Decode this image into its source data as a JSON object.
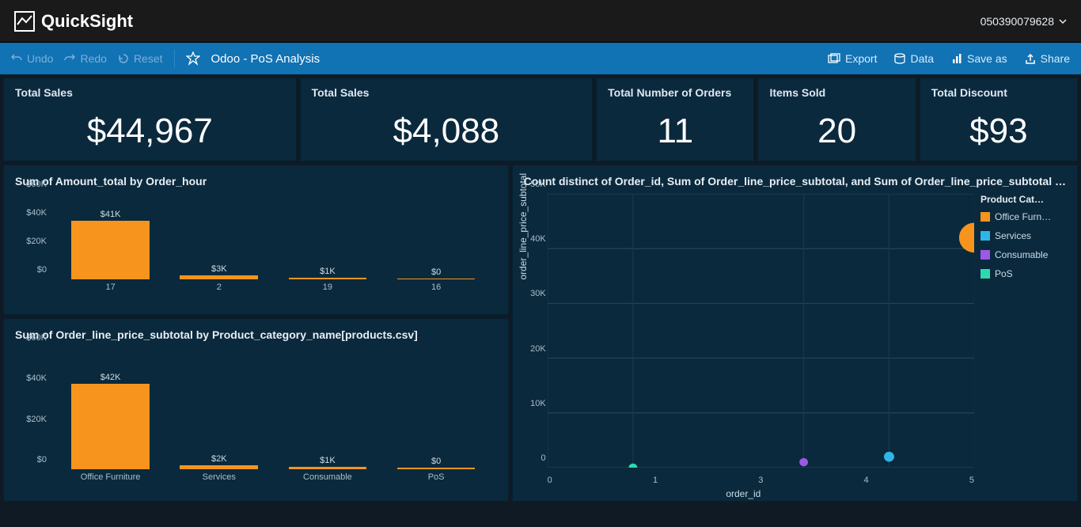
{
  "brand": "QuickSight",
  "account_id": "050390079628",
  "toolbar": {
    "undo": "Undo",
    "redo": "Redo",
    "reset": "Reset",
    "title": "Odoo - PoS Analysis",
    "export": "Export",
    "data": "Data",
    "save_as": "Save as",
    "share": "Share"
  },
  "kpis": [
    {
      "label": "Total Sales",
      "value": "$44,967",
      "wide": true
    },
    {
      "label": "Total Sales",
      "value": "$4,088",
      "wide": true
    },
    {
      "label": "Total Number of Orders",
      "value": "11",
      "wide": false
    },
    {
      "label": "Items Sold",
      "value": "20",
      "wide": false
    },
    {
      "label": "Total Discount",
      "value": "$93",
      "wide": false
    }
  ],
  "chart_data": [
    {
      "id": "chart1",
      "type": "bar",
      "title": "Sum of Amount_total by Order_hour",
      "ylabel": "",
      "xlabel": "",
      "ylim": [
        0,
        60000
      ],
      "yticks": [
        "$0",
        "$20K",
        "$40K",
        "$60K"
      ],
      "categories": [
        "17",
        "2",
        "19",
        "16"
      ],
      "values": [
        41000,
        3000,
        1000,
        0
      ],
      "value_labels": [
        "$41K",
        "$3K",
        "$1K",
        "$0"
      ]
    },
    {
      "id": "chart2",
      "type": "bar",
      "title": "Sum of Order_line_price_subtotal by Product_category_name[products.csv]",
      "ylabel": "",
      "xlabel": "",
      "ylim": [
        0,
        60000
      ],
      "yticks": [
        "$0",
        "$20K",
        "$40K",
        "$60K"
      ],
      "categories": [
        "Office Furniture",
        "Services",
        "Consumable",
        "PoS"
      ],
      "values": [
        42000,
        2000,
        1000,
        0
      ],
      "value_labels": [
        "$42K",
        "$2K",
        "$1K",
        "$0"
      ]
    },
    {
      "id": "scatter",
      "type": "scatter",
      "title": "Count distinct of Order_id, Sum of Order_line_price_subtotal, and Sum of Order_line_price_subtotal …",
      "xlabel": "order_id",
      "ylabel": "order_line_price_subtotal",
      "xlim": [
        0,
        5
      ],
      "ylim": [
        0,
        50000
      ],
      "xticks": [
        "0",
        "1",
        "3",
        "4",
        "5"
      ],
      "yticks": [
        "0",
        "10K",
        "20K",
        "30K",
        "40K",
        "50K"
      ],
      "legend_title": "Product Cat…",
      "series": [
        {
          "name": "Office Furn…",
          "color": "#f7941d",
          "points": [
            {
              "x": 5,
              "y": 42000,
              "r": 18
            }
          ]
        },
        {
          "name": "Services",
          "color": "#2fb6e8",
          "points": [
            {
              "x": 4,
              "y": 2000,
              "r": 6
            }
          ]
        },
        {
          "name": "Consumable",
          "color": "#9b59e6",
          "points": [
            {
              "x": 3,
              "y": 1000,
              "r": 5
            }
          ]
        },
        {
          "name": "PoS",
          "color": "#2fd8b0",
          "points": [
            {
              "x": 1,
              "y": 0,
              "r": 5
            }
          ]
        }
      ]
    }
  ]
}
